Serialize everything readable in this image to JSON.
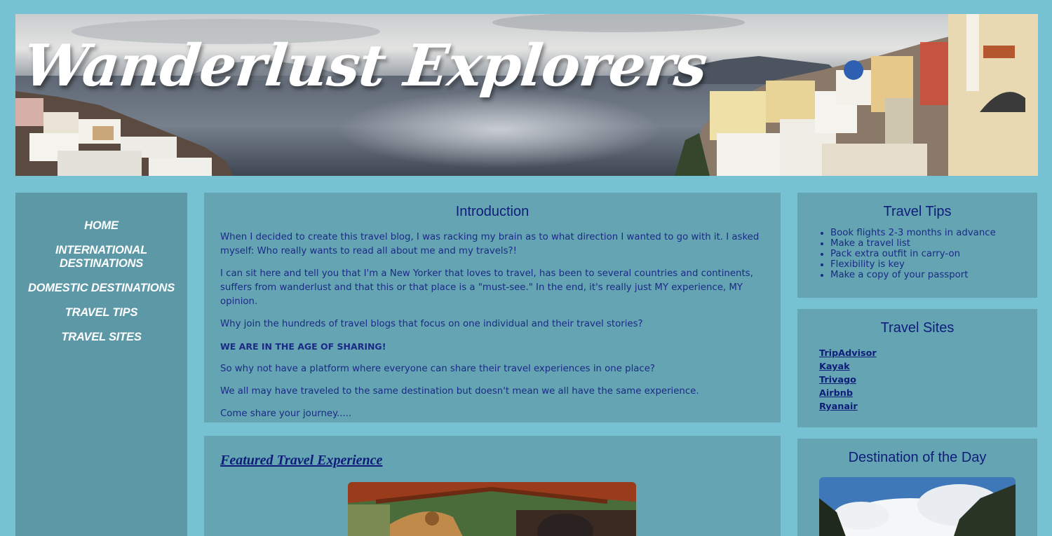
{
  "site": {
    "title": "Wanderlust Explorers"
  },
  "nav": {
    "items": [
      {
        "label": "HOME"
      },
      {
        "label": "INTERNATIONAL DESTINATIONS"
      },
      {
        "label": "DOMESTIC DESTINATIONS"
      },
      {
        "label": "TRAVEL TIPS"
      },
      {
        "label": "TRAVEL SITES"
      }
    ]
  },
  "intro": {
    "heading": "Introduction",
    "paragraphs": [
      "When I decided to create this travel blog, I was racking my brain as to what direction I wanted to go with it. I asked myself: Who really wants to read all about me and my travels?!",
      "I can sit here and tell you that I'm a New Yorker that loves to travel, has been to several countries and continents, suffers from wanderlust and that this or that place is a \"must-see.\" In the end, it's really just MY experience, MY opinion.",
      "Why join the hundreds of travel blogs that focus on one individual and their travel stories?",
      "WE ARE IN THE AGE OF SHARING!",
      "So why not have a platform where everyone can share their travel experiences in one place?",
      "We all may have traveled to the same destination but doesn't mean we all have the same experience.",
      "Come share your journey....."
    ]
  },
  "featured": {
    "link_label": "Featured Travel Experience"
  },
  "tips": {
    "heading": "Travel Tips",
    "items": [
      "Book flights 2-3 months in advance",
      "Make a travel list",
      "Pack extra outfit in carry-on",
      "Flexibility is key",
      "Make a copy of your passport"
    ]
  },
  "sites": {
    "heading": "Travel Sites",
    "links": [
      "TripAdvisor",
      "Kayak",
      "Trivago",
      "Airbnb",
      "Ryanair"
    ]
  },
  "destination": {
    "heading": "Destination of the Day"
  },
  "colors": {
    "page_background": "#76c2d3",
    "nav_background": "#5d98a7",
    "panel_background": "#65a5b3",
    "heading_text": "#0f1d7a",
    "nav_text": "#ffffff"
  }
}
